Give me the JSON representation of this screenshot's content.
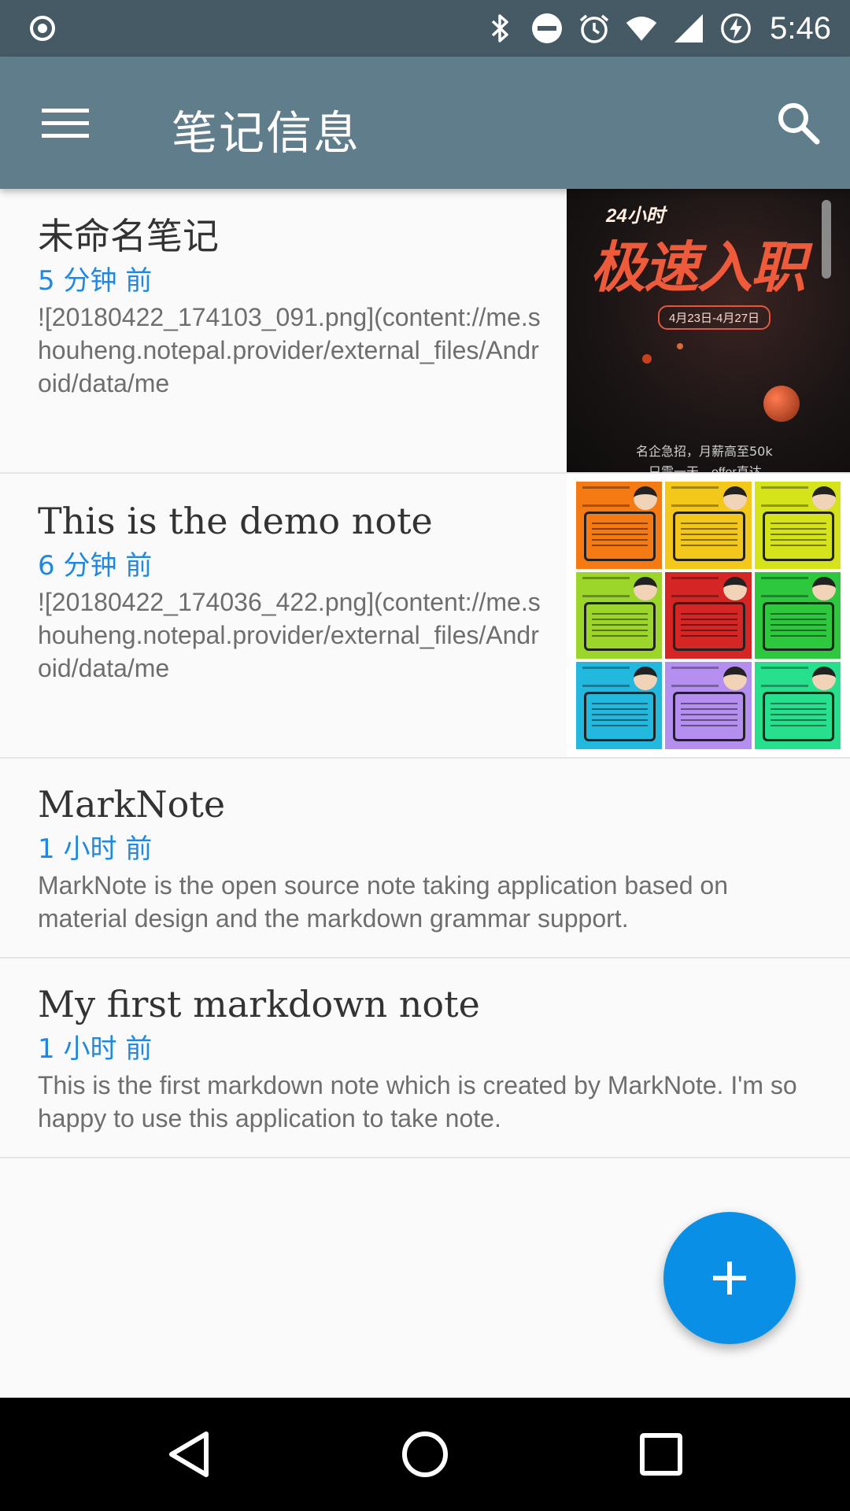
{
  "status_bar": {
    "time": "5:46",
    "icons": [
      "record-icon",
      "bluetooth-icon",
      "do-not-disturb-icon",
      "alarm-icon",
      "wifi-icon",
      "cell-signal-icon",
      "battery-charging-icon"
    ]
  },
  "app_bar": {
    "title": "笔记信息",
    "menu_icon": "menu-icon",
    "search_icon": "search-icon"
  },
  "notes": [
    {
      "title": "未命名笔记",
      "time": "5 分钟 前",
      "preview": "![20180422_174103_091.png](content://me.shouheng.notepal.provider/external_files/Android/data/me",
      "thumbnail": {
        "tag": "24小时",
        "headline": "极速入职",
        "date": "4月23日-4月27日",
        "sub1": "名企急招，月薪高至50k",
        "sub2": "只需一天，offer直达"
      }
    },
    {
      "title": "This is the demo note",
      "time": "6 分钟 前",
      "preview": "![20180422_174036_422.png](content://me.shouheng.notepal.provider/external_files/Android/data/me"
    },
    {
      "title": "MarkNote",
      "time": "1 小时 前",
      "preview": "MarkNote is the open source note taking application based on material design and the markdown grammar support."
    },
    {
      "title": "My first markdown note",
      "time": "1 小时 前",
      "preview": "This is the first markdown note which is created by MarkNote. I'm so happy to use this application to take note."
    }
  ],
  "tile_colors": [
    "#f57a14",
    "#f3c81b",
    "#d4e31a",
    "#9cd62a",
    "#d52525",
    "#2ec83f",
    "#23b9df",
    "#b48ff0",
    "#27e08e"
  ],
  "fab": {
    "icon": "add-icon",
    "color": "#0a8fe6"
  },
  "nav_bar": {
    "icons": [
      "back-icon",
      "home-icon",
      "recents-icon"
    ]
  },
  "colors": {
    "status_bar": "#455a64",
    "app_bar": "#607d8b",
    "time_text": "#1e88e5"
  }
}
